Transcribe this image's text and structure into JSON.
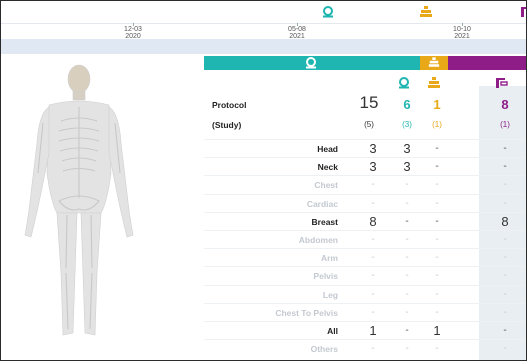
{
  "timeline": {
    "ticks": [
      {
        "date": "12-03",
        "year": "2020"
      },
      {
        "date": "05-08",
        "year": "2021"
      },
      {
        "date": "10-10",
        "year": "2021"
      }
    ],
    "markers": [
      "ct-icon",
      "xray-icon",
      "mammo-icon"
    ]
  },
  "colors": {
    "ct": "#1fb5b0",
    "xray": "#e9a817",
    "mammo": "#8e1d88",
    "shade": "#e8eef2",
    "band": "#dfe8f3"
  },
  "table": {
    "rows": [
      {
        "label": "Protocol",
        "total": "15",
        "ct": "6",
        "xray": "1",
        "mammo": "8"
      },
      {
        "label": "(Study)",
        "total": "(5)",
        "ct": "(3)",
        "xray": "(1)",
        "mammo": "(1)"
      }
    ],
    "regions": [
      {
        "label": "Head",
        "total": "3",
        "ct": "3",
        "xray": "-",
        "mammo": "-",
        "active": true
      },
      {
        "label": "Neck",
        "total": "3",
        "ct": "3",
        "xray": "-",
        "mammo": "-",
        "active": true
      },
      {
        "label": "Chest",
        "total": "-",
        "ct": "-",
        "xray": "-",
        "mammo": "-",
        "active": false
      },
      {
        "label": "Cardiac",
        "total": "-",
        "ct": "-",
        "xray": "-",
        "mammo": "-",
        "active": false
      },
      {
        "label": "Breast",
        "total": "8",
        "ct": "-",
        "xray": "-",
        "mammo": "8",
        "active": true
      },
      {
        "label": "Abdomen",
        "total": "-",
        "ct": "-",
        "xray": "-",
        "mammo": "-",
        "active": false
      },
      {
        "label": "Arm",
        "total": "-",
        "ct": "-",
        "xray": "-",
        "mammo": "-",
        "active": false
      },
      {
        "label": "Pelvis",
        "total": "-",
        "ct": "-",
        "xray": "-",
        "mammo": "-",
        "active": false
      },
      {
        "label": "Leg",
        "total": "-",
        "ct": "-",
        "xray": "-",
        "mammo": "-",
        "active": false
      },
      {
        "label": "Chest To Pelvis",
        "total": "-",
        "ct": "-",
        "xray": "-",
        "mammo": "-",
        "active": false
      },
      {
        "label": "All",
        "total": "1",
        "ct": "-",
        "xray": "1",
        "mammo": "-",
        "active": true
      },
      {
        "label": "Others",
        "total": "-",
        "ct": "-",
        "xray": "-",
        "mammo": "-",
        "active": false
      }
    ]
  }
}
